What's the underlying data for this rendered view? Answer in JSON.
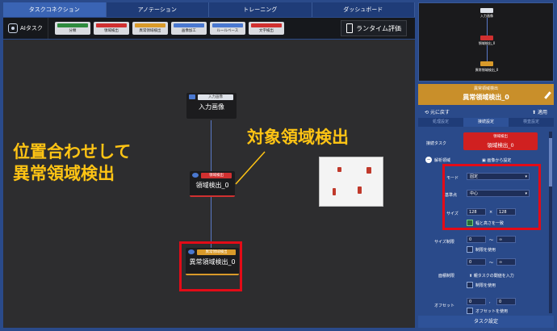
{
  "tabs": [
    "タスクコネクション",
    "アノテーション",
    "トレーニング",
    "ダッシュボード"
  ],
  "toolbar": {
    "ai_label": "AIタスク",
    "chips": [
      {
        "label": "分類",
        "color": "#2e8b3e"
      },
      {
        "label": "領域検出",
        "color": "#d03030"
      },
      {
        "label": "異常領域検出",
        "color": "#d99a2a"
      },
      {
        "label": "画像加工",
        "color": "#4a78d0"
      },
      {
        "label": "ルールベース",
        "color": "#4a78d0"
      },
      {
        "label": "文字検出",
        "color": "#d03030"
      }
    ],
    "runtime_label": "ランタイム評価"
  },
  "canvas": {
    "node_input": {
      "tag": "入力画像",
      "title": "入力画像"
    },
    "node_region": {
      "tag": "領域検出",
      "title": "領域検出_0"
    },
    "node_anomaly": {
      "tag": "異常領域検出",
      "title": "異常領域検出_0"
    },
    "label_left": [
      "位置合わせして",
      "異常領域検出"
    ],
    "label_right": "対象領域検出"
  },
  "right": {
    "mini_labels": [
      "入力画像",
      "領域検出_0",
      "異常領域検出_0"
    ],
    "selected_type": "異常領域検出",
    "selected_name": "異常領域検出_0",
    "undo": "元に戻す",
    "apply": "適用",
    "subtabs": [
      "処理設定",
      "接続設定",
      "検査設定"
    ],
    "connect_task_label": "接続タスク",
    "connect_task_type": "領域検出",
    "connect_task_name": "領域検出_0",
    "analysis_area": "解析領域",
    "set_from_image": "画像から設定",
    "mode_label": "モード",
    "mode_value": "固定",
    "ref_label": "基準点",
    "ref_value": "中心",
    "size_label": "サイズ",
    "size_w": "128",
    "size_h": "128",
    "size_times": "×",
    "same_wh": "幅と高さを一致",
    "size_limit_label": "サイズ制限",
    "size_limit_min": "0",
    "size_limit_tilde": "〜",
    "size_limit_max": "∞",
    "use_limit": "制限を使用",
    "area_limit_label": "面積制限",
    "area_limit_min": "0",
    "area_limit_tilde": "〜",
    "area_limit_max": "∞",
    "area_threshold": "親タスクの閾値を入力",
    "use_limit2": "制限を使用",
    "offset_label": "オフセット",
    "offset_x": "0",
    "offset_comma": ",",
    "offset_y": "0",
    "use_offset": "オフセットを使用",
    "footer": "タスク設定"
  }
}
